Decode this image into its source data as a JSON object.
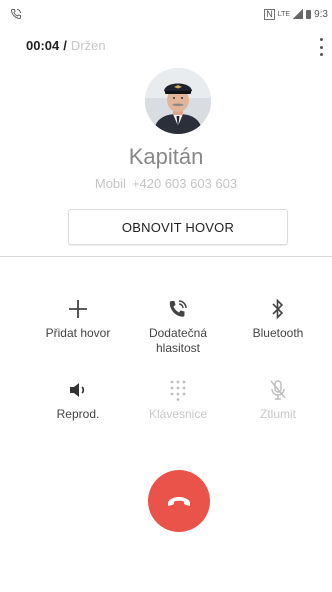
{
  "status_bar": {
    "left_icon": "phone-call-icon",
    "time": "9:3",
    "icons": [
      "nfc-icon",
      "lte-icon",
      "signal-icon",
      "battery-icon"
    ]
  },
  "call": {
    "timer": "00:04",
    "separator": "/",
    "hold_status": "Držen"
  },
  "contact": {
    "name": "Kapitán",
    "number_label": "Mobil",
    "number": "+420 603 603 603",
    "avatar": "avatar-photo"
  },
  "resume_button": {
    "label": "OBNOVIT HOVOR"
  },
  "actions": [
    {
      "label": "Přidat hovor",
      "icon": "plus-icon",
      "enabled": true
    },
    {
      "label": "Dodatečná hlasitost",
      "icon": "extra-volume-icon",
      "enabled": true
    },
    {
      "label": "Bluetooth",
      "icon": "bluetooth-icon",
      "enabled": true
    },
    {
      "label": "Reprod.",
      "icon": "speaker-icon",
      "enabled": true
    },
    {
      "label": "Klávesnice",
      "icon": "keypad-icon",
      "enabled": false
    },
    {
      "label": "Ztlumit",
      "icon": "mute-mic-icon",
      "enabled": false
    }
  ],
  "end_call": {
    "icon": "end-call-icon",
    "color": "#ea5349"
  },
  "colors": {
    "accent_red": "#ea5349",
    "disabled_text": "#c8c8c8",
    "divider": "#d6d6d6"
  }
}
